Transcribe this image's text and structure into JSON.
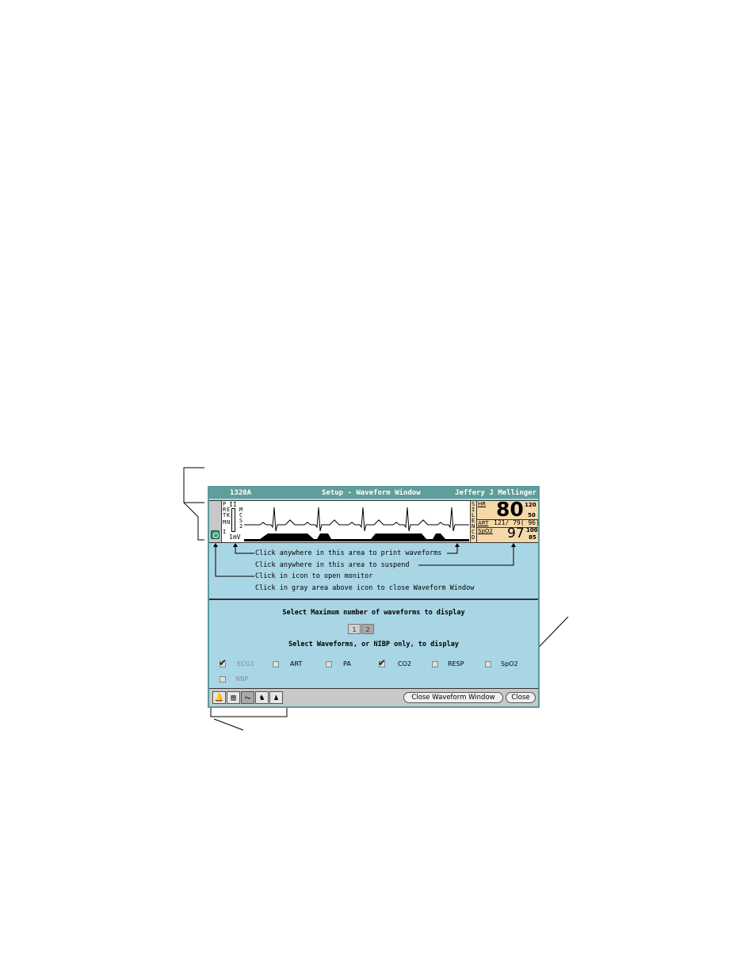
{
  "window": {
    "bed_label": "1320A",
    "title": "Setup - Waveform Window",
    "patient": "Jeffery J Mellinger"
  },
  "waveform": {
    "left_letters": [
      "P",
      "R",
      "E",
      "T",
      "K",
      "M",
      "N",
      "I"
    ],
    "lead": "II",
    "mid_letters": [
      "M",
      "C",
      "S",
      "2"
    ],
    "scale": "1mV"
  },
  "vitals": {
    "side_letters": [
      "S",
      "I",
      "L",
      "E",
      "N",
      "C",
      "D"
    ],
    "hr_label": "HR",
    "hr_value": "80",
    "hr_high": "120",
    "hr_low": "50",
    "art_label": "ART",
    "art_value": "121/ 79(  96)",
    "spo2_label": "SpO2",
    "spo2_value": "97",
    "spo2_high": "100",
    "spo2_low": "85"
  },
  "annotations": {
    "print": "Click anywhere in this area to print waveforms",
    "suspend": "Click anywhere in this area to suspend",
    "open_monitor": "Click in icon to open monitor",
    "close_window": "Click in gray area above icon to close Waveform Window"
  },
  "setup": {
    "max_label": "Select Maximum number of waveforms to display",
    "options": [
      "1",
      "2"
    ],
    "selected": "2",
    "select_label": "Select Waveforms, or NIBP only, to display",
    "waveforms": [
      {
        "label": "ECG1",
        "checked": true,
        "enabled": false
      },
      {
        "label": "ART",
        "checked": false,
        "enabled": true
      },
      {
        "label": "PA",
        "checked": false,
        "enabled": true
      },
      {
        "label": "CO2",
        "checked": true,
        "enabled": true
      },
      {
        "label": "RESP",
        "checked": false,
        "enabled": true
      },
      {
        "label": "SpO2",
        "checked": false,
        "enabled": true
      },
      {
        "label": "NBP",
        "checked": false,
        "enabled": false
      }
    ]
  },
  "toolbar": {
    "icons": [
      "bell-icon",
      "document-icon",
      "waveform-icon",
      "alarm-bell-icon",
      "patient-alarm-icon"
    ],
    "close_waveform_label": "Close Waveform Window",
    "close_label": "Close"
  },
  "colors": {
    "window_bg": "#a9d6e5",
    "title_bar": "#5f9e9a",
    "vitals_bg": "#f5d9a8",
    "monitor_icon": "#3a9a80"
  }
}
